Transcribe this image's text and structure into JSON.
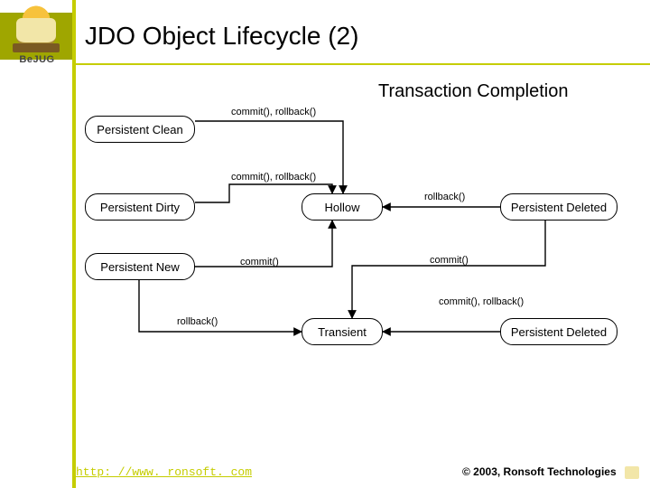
{
  "logo": {
    "text": "BeJUG"
  },
  "title": "JDO Object Lifecycle (2)",
  "section_heading": "Transaction Completion",
  "states": {
    "persistent_clean": "Persistent Clean",
    "persistent_dirty": "Persistent Dirty",
    "persistent_new": "Persistent New",
    "hollow": "Hollow",
    "persistent_deleted_a": "Persistent Deleted",
    "transient": "Transient",
    "persistent_deleted_b": "Persistent Deleted"
  },
  "labels": {
    "clean_to_hollow": "commit(), rollback()",
    "dirty_to_hollow": "commit(), rollback()",
    "deleted_to_hollow": "rollback()",
    "new_to_hollow": "commit()",
    "deleted_a_to_transient": "commit()",
    "deleted_b_to_transient": "commit(), rollback()",
    "new_to_transient": "rollback()"
  },
  "footer": {
    "url": "http: //www. ronsoft. com",
    "copyright": "© 2003, Ronsoft Technologies"
  }
}
